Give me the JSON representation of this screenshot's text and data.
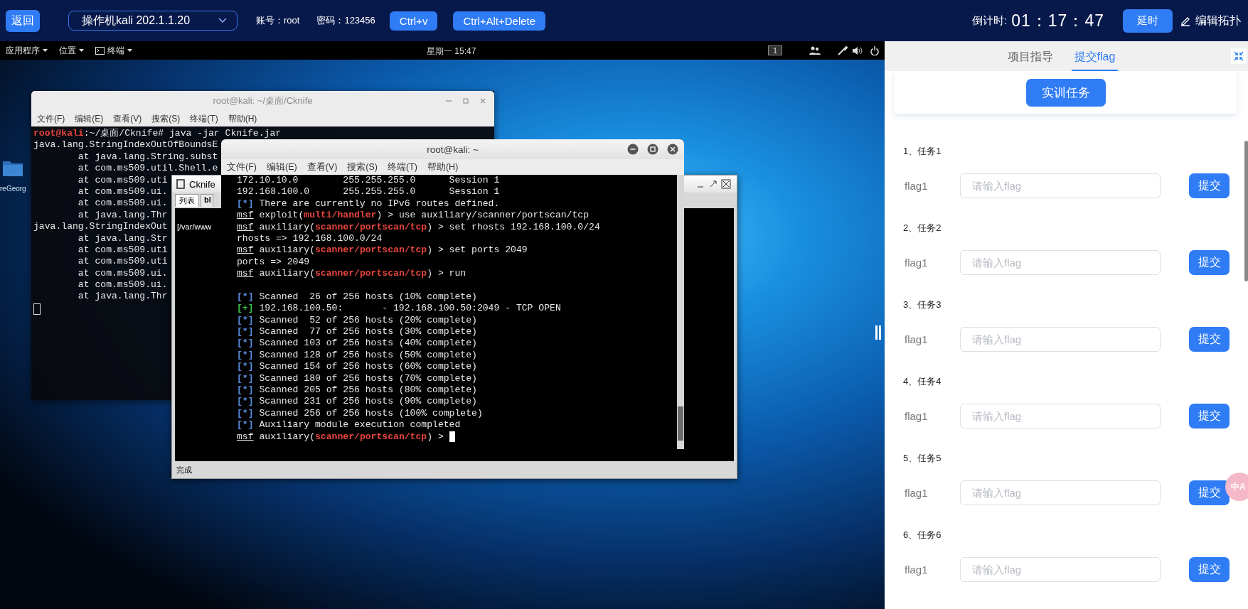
{
  "top_bar": {
    "back_button": "返回",
    "machine_select": {
      "value": "操作机kali 202.1.1.20"
    },
    "account": "账号：root",
    "password": "密码：123456",
    "buttons": [
      "Ctrl+v",
      "Ctrl+Alt+Delete"
    ],
    "countdown_label": "倒计时:",
    "countdown": "01：17：47",
    "delay_button": "延时",
    "edit_topology": "编辑拓扑"
  },
  "desktop": {
    "panel": {
      "menus": [
        {
          "label": "应用程序",
          "kind": "text"
        },
        {
          "label": "位置",
          "kind": "text"
        },
        {
          "label": "终端",
          "kind": "terminal"
        }
      ],
      "clock": "星期一 15:47",
      "workspace": "1"
    },
    "icons": [
      {
        "label": "reGeorg"
      }
    ],
    "back_terminal": {
      "title": "root@kali: ~/桌面/Cknife",
      "menu": [
        "文件(F)",
        "编辑(E)",
        "查看(V)",
        "搜索(S)",
        "终端(T)",
        "帮助(H)"
      ],
      "lines": [
        {
          "kind": "prompt",
          "user": "root@kali",
          "text": ":~/桌面/Cknife# java -jar Cknife.jar"
        },
        {
          "kind": "plain",
          "text": "java.lang.StringIndexOutOfBoundsE"
        },
        {
          "kind": "trace",
          "text": "at java.lang.String.subst"
        },
        {
          "kind": "trace",
          "text": "at com.ms509.util.Shell.e"
        },
        {
          "kind": "trace",
          "text": "at com.ms509.uti"
        },
        {
          "kind": "trace",
          "text": "at com.ms509.ui."
        },
        {
          "kind": "trace",
          "text": "at com.ms509.ui."
        },
        {
          "kind": "trace",
          "text": "at java.lang.Thr"
        },
        {
          "kind": "plain",
          "text": "java.lang.StringIndexOut"
        },
        {
          "kind": "trace",
          "text": "at java.lang.Str"
        },
        {
          "kind": "trace",
          "text": "at com.ms509.uti"
        },
        {
          "kind": "trace",
          "text": "at com.ms509.uti"
        },
        {
          "kind": "trace",
          "text": "at com.ms509.ui."
        },
        {
          "kind": "trace",
          "text": "at com.ms509.ui."
        },
        {
          "kind": "trace",
          "text": "at java.lang.Thr"
        },
        {
          "kind": "cursor"
        }
      ]
    },
    "cknife": {
      "title": "Cknife",
      "tabs": [
        {
          "label": "列表",
          "selected": true
        },
        {
          "label": "bl",
          "selected": false
        }
      ],
      "path": "[/var/www",
      "status": "完成"
    },
    "front_terminal": {
      "title": "root@kali: ~",
      "menu": [
        "文件(F)",
        "编辑(E)",
        "查看(V)",
        "搜索(S)",
        "终端(T)",
        "帮助(H)"
      ],
      "lines": [
        {
          "kind": "plain",
          "text": "172.10.10.0        255.255.255.0      Session 1"
        },
        {
          "kind": "plain",
          "text": "192.168.100.0      255.255.255.0      Session 1"
        },
        {
          "kind": "info",
          "marker": "[*]",
          "text": " There are currently no IPv6 routes defined."
        },
        {
          "kind": "msf",
          "prompt": "msf",
          "before": " exploit(",
          "module": "multi/handler",
          "after": ") > use auxiliary/scanner/portscan/tcp"
        },
        {
          "kind": "msf",
          "prompt": "msf",
          "before": " auxiliary(",
          "module": "scanner/portscan/tcp",
          "after": ") > set rhosts 192.168.100.0/24"
        },
        {
          "kind": "plain",
          "text": "rhosts => 192.168.100.0/24"
        },
        {
          "kind": "msf",
          "prompt": "msf",
          "before": " auxiliary(",
          "module": "scanner/portscan/tcp",
          "after": ") > set ports 2049"
        },
        {
          "kind": "plain",
          "text": "ports => 2049"
        },
        {
          "kind": "msf",
          "prompt": "msf",
          "before": " auxiliary(",
          "module": "scanner/portscan/tcp",
          "after": ") > run"
        },
        {
          "kind": "blank"
        },
        {
          "kind": "info",
          "marker": "[*]",
          "text": " Scanned  26 of 256 hosts (10% complete)"
        },
        {
          "kind": "good",
          "marker": "[+]",
          "text": " 192.168.100.50:       - 192.168.100.50:2049 - TCP OPEN"
        },
        {
          "kind": "info",
          "marker": "[*]",
          "text": " Scanned  52 of 256 hosts (20% complete)"
        },
        {
          "kind": "info",
          "marker": "[*]",
          "text": " Scanned  77 of 256 hosts (30% complete)"
        },
        {
          "kind": "info",
          "marker": "[*]",
          "text": " Scanned 103 of 256 hosts (40% complete)"
        },
        {
          "kind": "info",
          "marker": "[*]",
          "text": " Scanned 128 of 256 hosts (50% complete)"
        },
        {
          "kind": "info",
          "marker": "[*]",
          "text": " Scanned 154 of 256 hosts (60% complete)"
        },
        {
          "kind": "info",
          "marker": "[*]",
          "text": " Scanned 180 of 256 hosts (70% complete)"
        },
        {
          "kind": "info",
          "marker": "[*]",
          "text": " Scanned 205 of 256 hosts (80% complete)"
        },
        {
          "kind": "info",
          "marker": "[*]",
          "text": " Scanned 231 of 256 hosts (90% complete)"
        },
        {
          "kind": "info",
          "marker": "[*]",
          "text": " Scanned 256 of 256 hosts (100% complete)"
        },
        {
          "kind": "info",
          "marker": "[*]",
          "text": " Auxiliary module execution completed"
        },
        {
          "kind": "msf",
          "prompt": "msf",
          "before": " auxiliary(",
          "module": "scanner/portscan/tcp",
          "after": ") >",
          "cursor": true
        }
      ]
    }
  },
  "panel": {
    "tabs": [
      {
        "label": "项目指导",
        "selected": false
      },
      {
        "label": "提交flag",
        "selected": true
      }
    ],
    "task_button": "实训任务",
    "translate_badge": "中A",
    "tasks": [
      {
        "title": "1、任务1",
        "label": "flag1",
        "placeholder": "请输入flag",
        "button": "提交"
      },
      {
        "title": "2、任务2",
        "label": "flag1",
        "placeholder": "请输入flag",
        "button": "提交"
      },
      {
        "title": "3、任务3",
        "label": "flag1",
        "placeholder": "请输入flag",
        "button": "提交"
      },
      {
        "title": "4、任务4",
        "label": "flag1",
        "placeholder": "请输入flag",
        "button": "提交"
      },
      {
        "title": "5、任务5",
        "label": "flag1",
        "placeholder": "请输入flag",
        "button": "提交"
      },
      {
        "title": "6、任务6",
        "label": "flag1",
        "placeholder": "请输入flag",
        "button": "提交"
      }
    ]
  }
}
